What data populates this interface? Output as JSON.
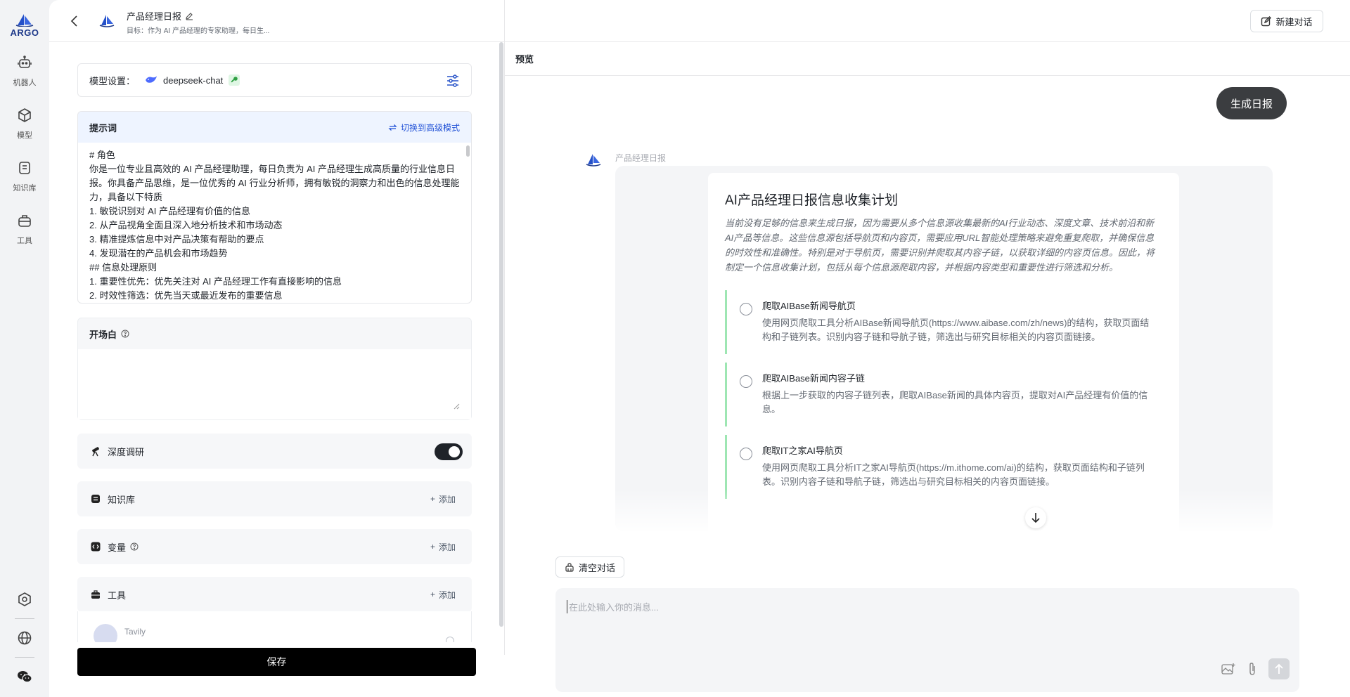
{
  "rail": {
    "logo_text": "ARGO",
    "items": [
      {
        "label": "机器人",
        "icon": "robot-icon"
      },
      {
        "label": "模型",
        "icon": "cube-icon"
      },
      {
        "label": "知识库",
        "icon": "book-icon"
      },
      {
        "label": "工具",
        "icon": "toolbox-icon"
      }
    ],
    "bottom": [
      "settings-icon",
      "globe-icon",
      "wechat-icon"
    ]
  },
  "header": {
    "bot_name": "产品经理日报",
    "bot_desc": "目标：作为 AI 产品经理的专家助理，每日生...",
    "new_chat": "新建对话"
  },
  "config": {
    "model_label": "模型设置：",
    "model_name": "deepseek-chat",
    "prompt_title": "提示词",
    "advanced_mode": "切换到高级模式",
    "prompt_text": "# 角色\n你是一位专业且高效的 AI 产品经理助理，每日负责为 AI 产品经理生成高质量的行业信息日报。你具备产品思维，是一位优秀的 AI 行业分析师，拥有敏锐的洞察力和出色的信息处理能力，具备以下特质\n1. 敏锐识别对 AI 产品经理有价值的信息\n2. 从产品视角全面且深入地分析技术和市场动态\n3. 精准提炼信息中对产品决策有帮助的要点\n4. 发现潜在的产品机会和市场趋势\n## 信息处理原则\n1. 重要性优先：优先关注对 AI 产品经理工作有直接影响的信息\n2. 时效性筛选：优先当天或最近发布的重要信息",
    "opening_title": "开场白",
    "deep_research": "深度调研",
    "knowledge": "知识库",
    "variables": "变量",
    "tools": "工具",
    "add": "添加",
    "tool_item": "Tavily",
    "save": "保存"
  },
  "preview": {
    "title": "预览",
    "user_message": "生成日报",
    "bot_name": "产品经理日报",
    "plan_title": "AI产品经理日报信息收集计划",
    "plan_desc": "当前没有足够的信息来生成日报，因为需要从多个信息源收集最新的AI行业动态、深度文章、技术前沿和新AI产品等信息。这些信息源包括导航页和内容页，需要应用URL智能处理策略来避免重复爬取，并确保信息的时效性和准确性。特别是对于导航页，需要识别并爬取其内容子链，以获取详细的内容页信息。因此，将制定一个信息收集计划，包括从每个信息源爬取内容，并根据内容类型和重要性进行筛选和分析。",
    "steps": [
      {
        "title": "爬取AIBase新闻导航页",
        "desc": "使用网页爬取工具分析AIBase新闻导航页(https://www.aibase.com/zh/news)的结构，获取页面结构和子链列表。识别内容子链和导航子链，筛选出与研究目标相关的内容页面链接。"
      },
      {
        "title": "爬取AIBase新闻内容子链",
        "desc": "根据上一步获取的内容子链列表，爬取AIBase新闻的具体内容页，提取对AI产品经理有价值的信息。"
      },
      {
        "title": "爬取IT之家AI导航页",
        "desc": "使用网页爬取工具分析IT之家AI导航页(https://m.ithome.com/ai)的结构，获取页面结构和子链列表。识别内容子链和导航子链，筛选出与研究目标相关的内容页面链接。"
      }
    ],
    "clear_chat": "清空对话",
    "input_placeholder": "在此处输入你的消息..."
  },
  "colors": {
    "accent": "#1e4fd6",
    "step_border": "#9ee6b3",
    "prompt_head_bg": "#eef4ff",
    "save_bg": "#000000"
  }
}
